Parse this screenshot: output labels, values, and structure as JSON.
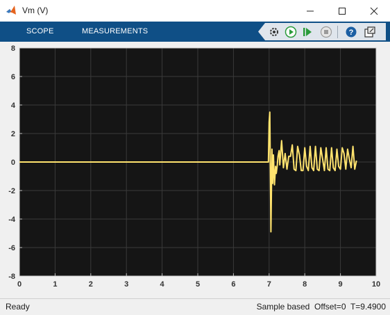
{
  "window": {
    "title": "Vm (V)"
  },
  "toolstrip": {
    "tabs": [
      {
        "label": "SCOPE"
      },
      {
        "label": "MEASUREMENTS"
      }
    ],
    "tools": [
      {
        "name": "settings-icon"
      },
      {
        "name": "run-icon"
      },
      {
        "name": "step-forward-icon"
      },
      {
        "name": "stop-icon"
      },
      {
        "name": "help-icon"
      },
      {
        "name": "undock-icon"
      }
    ]
  },
  "status": {
    "left": "Ready",
    "mode": "Sample based",
    "offset": "Offset=0",
    "time": "T=9.4900"
  },
  "colors": {
    "accent": "#0f4f86",
    "plot_bg": "#151515",
    "trace": "#ffe36e",
    "grid": "#3a3a3a"
  },
  "chart_data": {
    "type": "line",
    "title": "",
    "xlabel": "",
    "ylabel": "",
    "xlim": [
      0,
      10
    ],
    "ylim": [
      -8,
      8
    ],
    "xticks": [
      "0",
      "1",
      "2",
      "3",
      "4",
      "5",
      "6",
      "7",
      "8",
      "9",
      "10"
    ],
    "yticks": [
      "8",
      "6",
      "4",
      "2",
      "0",
      "-2",
      "-4",
      "-6",
      "-8"
    ],
    "grid": true,
    "series": [
      {
        "name": "",
        "x": [
          0,
          6.98,
          7.0,
          7.02,
          7.05,
          7.08,
          7.1,
          7.12,
          7.15,
          7.18,
          7.2,
          7.23,
          7.25,
          7.28,
          7.3,
          7.35,
          7.4,
          7.45,
          7.5,
          7.55,
          7.6,
          7.65,
          7.7,
          7.75,
          7.8,
          7.85,
          7.9,
          7.95,
          8.0,
          8.05,
          8.1,
          8.15,
          8.2,
          8.25,
          8.3,
          8.35,
          8.4,
          8.45,
          8.5,
          8.55,
          8.6,
          8.65,
          8.7,
          8.75,
          8.8,
          8.85,
          8.9,
          8.95,
          9.0,
          9.05,
          9.1,
          9.15,
          9.2,
          9.25,
          9.3,
          9.35,
          9.4,
          9.45
        ],
        "y": [
          0,
          0,
          2.8,
          3.5,
          -4.9,
          0.9,
          -1.5,
          0.5,
          -1.6,
          -0.3,
          -0.8,
          -0.2,
          0.4,
          0.8,
          -0.2,
          1.5,
          -0.4,
          0.6,
          -0.5,
          0.4,
          0.4,
          1.2,
          -0.5,
          -0.6,
          1.1,
          0.5,
          -0.6,
          -0.6,
          1.0,
          -0.3,
          -0.6,
          1.1,
          -0.4,
          -0.6,
          1.1,
          -0.5,
          -0.6,
          1.0,
          0.2,
          -0.6,
          1.0,
          -0.5,
          -0.6,
          1.0,
          -0.4,
          -0.6,
          0.9,
          -0.3,
          -0.5,
          1.0,
          0.6,
          -0.5,
          0.9,
          0.2,
          -0.4,
          1.1,
          -0.5,
          0.1
        ]
      }
    ]
  }
}
